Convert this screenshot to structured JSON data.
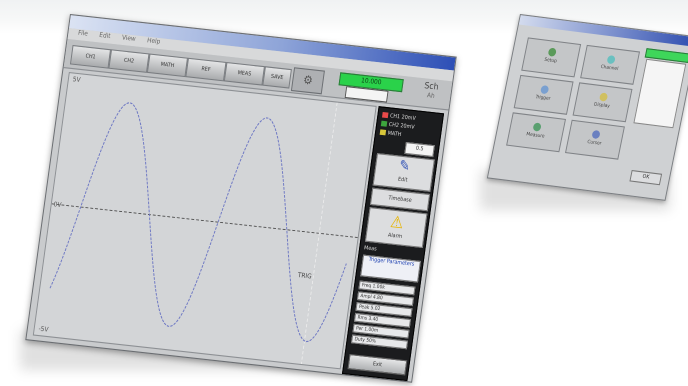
{
  "main_window": {
    "title": "",
    "menu": [
      "File",
      "Edit",
      "View",
      "Help"
    ],
    "toolbar_buttons": [
      "CH1",
      "CH2",
      "MATH",
      "REF",
      "MEAS",
      "SAVE"
    ],
    "brand": "Sch",
    "brand_sub": "Ah",
    "readout_value": "10.000",
    "plot": {
      "top_label": "5V",
      "zero_label": "0V",
      "bottom_label": "-5V",
      "trigger_label": "TRIG",
      "trace_color": "#6f79c4",
      "grid_color": "#4a4a4a"
    },
    "side_panel": {
      "legend": [
        "CH1 20mV",
        "CH2 20mV",
        "MATH"
      ],
      "legend_colors": [
        "#e94a4a",
        "#3da53d",
        "#d7c63a"
      ],
      "value_box": "0.5",
      "edit_label": "Edit",
      "mode_label": "Timebase",
      "warning_label": "Alarm",
      "meas_header": "Meas",
      "meas_title": "Trigger Parameters",
      "meas_rows": [
        "Freq 1.00k",
        "Ampl 4.80",
        "Peak 5.02",
        "Rms 3.40",
        "Per 1.00m",
        "Duty 50%"
      ],
      "exit_label": "Exit"
    }
  },
  "secondary_window": {
    "buttons": [
      "Setup",
      "Channel",
      "Trigger",
      "Display",
      "Measure",
      "Cursor"
    ],
    "button_colors": [
      "#5a9a5a",
      "#6ac0c0",
      "#7aa0d0",
      "#d0c060",
      "#5aa070",
      "#6a80c0"
    ],
    "ok_label": "OK"
  }
}
